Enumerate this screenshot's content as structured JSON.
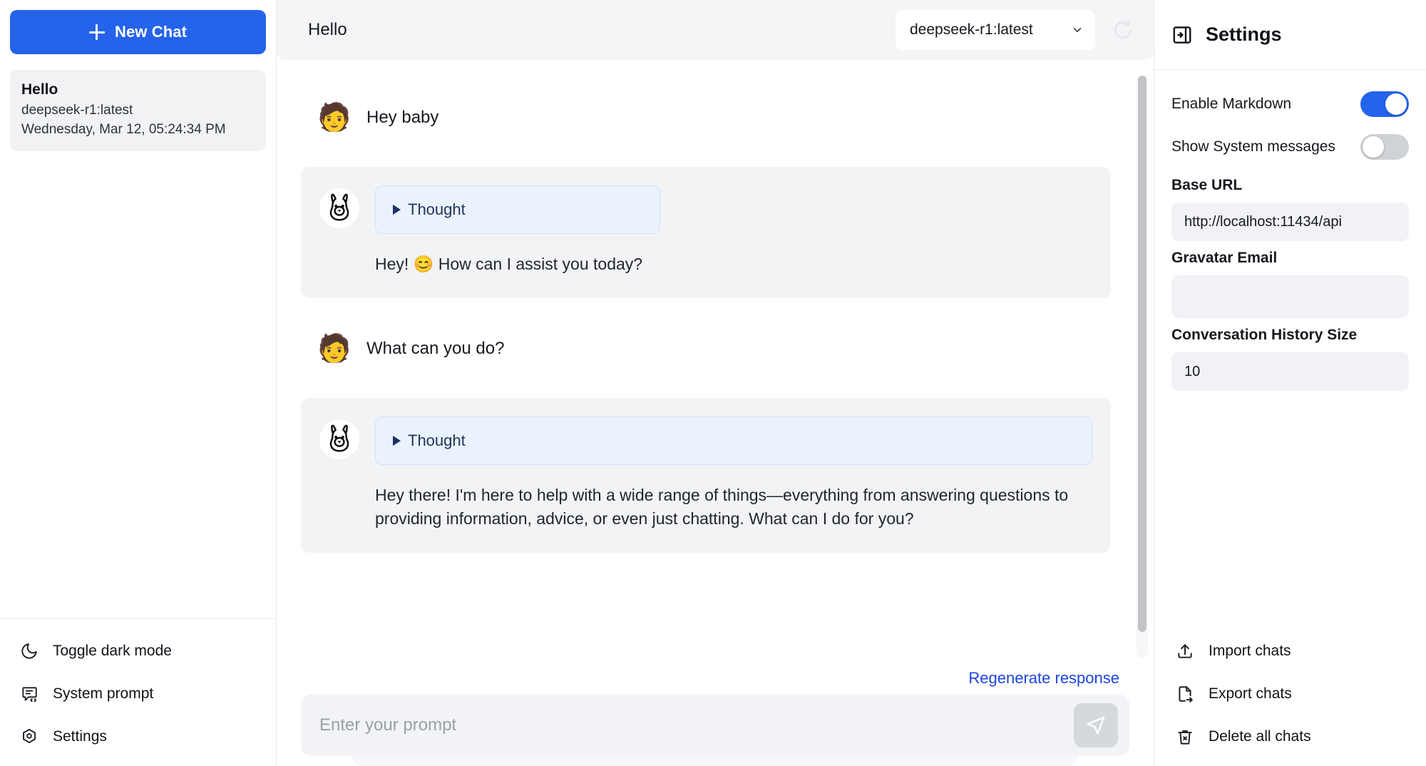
{
  "sidebar": {
    "new_chat_label": "New Chat",
    "new_chat_icon": "plus-icon",
    "chats": [
      {
        "title": "Hello",
        "model": "deepseek-r1:latest",
        "date": "Wednesday, Mar 12, 05:24:34 PM"
      }
    ],
    "footer_items": [
      {
        "label": "Toggle dark mode",
        "icon": "moon-icon"
      },
      {
        "label": "System prompt",
        "icon": "message-code-icon"
      },
      {
        "label": "Settings",
        "icon": "gear-hexagon-icon"
      }
    ]
  },
  "header": {
    "title": "Hello",
    "model_selected": "deepseek-r1:latest",
    "dropdown_icon": "chevron-down-icon",
    "refresh_icon": "refresh-icon"
  },
  "conversation": {
    "messages": [
      {
        "role": "user",
        "avatar": "person-emoji",
        "text": "Hey baby"
      },
      {
        "role": "assistant",
        "avatar": "llama-icon",
        "thought_label": "Thought",
        "thought_icon": "triangle-right-icon",
        "text": "Hey! 😊 How can I assist you today?"
      },
      {
        "role": "user",
        "avatar": "person-emoji",
        "text": "What can you do?"
      },
      {
        "role": "assistant",
        "avatar": "llama-icon",
        "thought_label": "Thought",
        "thought_icon": "triangle-right-icon",
        "text": "Hey there! I'm here to help with a wide range of things—everything from answering questions to providing information, advice, or even just chatting. What can I do for you?"
      }
    ]
  },
  "composer": {
    "regenerate_label": "Regenerate response",
    "placeholder": "Enter your prompt",
    "value": "",
    "send_icon": "send-icon"
  },
  "settings": {
    "title": "Settings",
    "panel_icon": "panel-collapse-icon",
    "toggles": [
      {
        "label": "Enable Markdown",
        "state": "on"
      },
      {
        "label": "Show System messages",
        "state": "off"
      }
    ],
    "fields": [
      {
        "label": "Base URL",
        "value": "http://localhost:11434/api",
        "placeholder": ""
      },
      {
        "label": "Gravatar Email",
        "value": "",
        "placeholder": ""
      },
      {
        "label": "Conversation History Size",
        "value": "10",
        "placeholder": ""
      }
    ],
    "actions": [
      {
        "label": "Import chats",
        "icon": "upload-icon"
      },
      {
        "label": "Export chats",
        "icon": "file-export-icon"
      },
      {
        "label": "Delete all chats",
        "icon": "trash-icon"
      }
    ]
  },
  "colors": {
    "accent": "#2563eb",
    "link": "#1c44e0",
    "thought_bg": "#eaf2fd",
    "thought_text": "#22345f",
    "message_bg": "#f2f3f5"
  }
}
